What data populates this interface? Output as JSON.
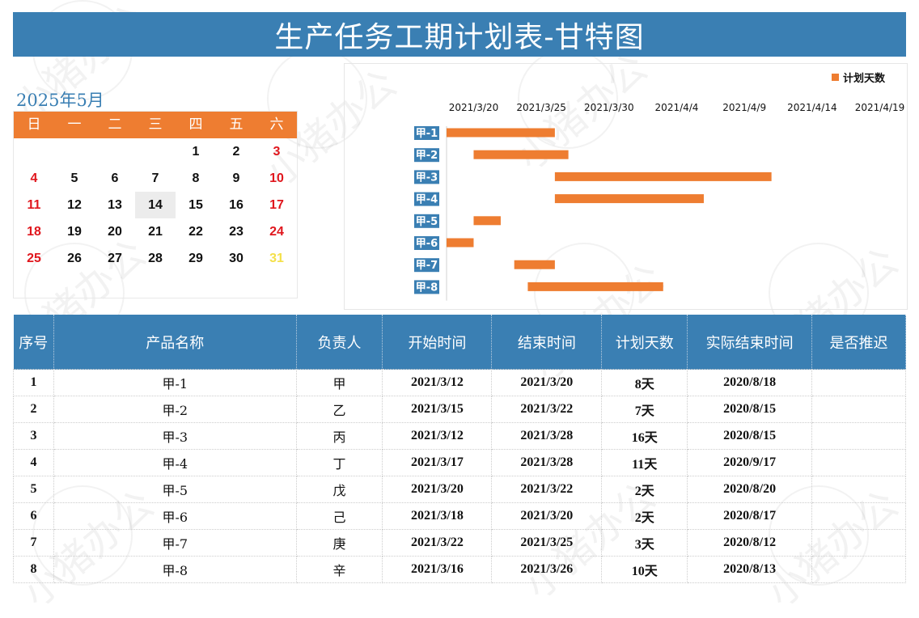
{
  "title": "生产任务工期计划表-甘特图",
  "watermark": "小猪办公",
  "colors": {
    "header_blue": "#3a7fb3",
    "accent_orange": "#ee7d31",
    "weekend_red": "#e0161d",
    "highlight_yellow": "#f4e04a"
  },
  "calendar": {
    "title": "2025年5月",
    "weekdays": [
      "日",
      "一",
      "二",
      "三",
      "四",
      "五",
      "六"
    ],
    "weeks": [
      [
        "",
        "",
        "",
        "",
        "1",
        "2",
        "3"
      ],
      [
        "4",
        "5",
        "6",
        "7",
        "8",
        "9",
        "10"
      ],
      [
        "11",
        "12",
        "13",
        "14",
        "15",
        "16",
        "17"
      ],
      [
        "18",
        "19",
        "20",
        "21",
        "22",
        "23",
        "24"
      ],
      [
        "25",
        "26",
        "27",
        "28",
        "29",
        "30",
        "31"
      ]
    ],
    "today": "14"
  },
  "chart_data": {
    "type": "bar",
    "orientation": "horizontal-gantt",
    "legend": [
      "计划天数"
    ],
    "legend_position": "top-right",
    "x_ticks": [
      "2021/3/20",
      "2021/3/25",
      "2021/3/30",
      "2021/4/4",
      "2021/4/9",
      "2021/4/14",
      "2021/4/19"
    ],
    "xlim": [
      "2021/3/18",
      "2021/4/21"
    ],
    "categories": [
      "甲-1",
      "甲-2",
      "甲-3",
      "甲-4",
      "甲-5",
      "甲-6",
      "甲-7",
      "甲-8"
    ],
    "series": [
      {
        "name": "计划天数",
        "color": "#ee7d31",
        "start": [
          "2021/3/18",
          "2021/3/20",
          "2021/3/26",
          "2021/3/26",
          "2021/3/20",
          "2021/3/18",
          "2021/3/23",
          "2021/3/24"
        ],
        "end": [
          "2021/3/26",
          "2021/3/27",
          "2021/4/11",
          "2021/4/6",
          "2021/3/22",
          "2021/3/20",
          "2021/3/26",
          "2021/4/3"
        ]
      }
    ],
    "grid": false
  },
  "table": {
    "headers": [
      "序号",
      "产品名称",
      "负责人",
      "开始时间",
      "结束时间",
      "计划天数",
      "实际结束时间",
      "是否推迟"
    ],
    "rows": [
      [
        "1",
        "甲-1",
        "甲",
        "2021/3/12",
        "2021/3/20",
        "8天",
        "2020/8/18",
        ""
      ],
      [
        "2",
        "甲-2",
        "乙",
        "2021/3/15",
        "2021/3/22",
        "7天",
        "2020/8/15",
        ""
      ],
      [
        "3",
        "甲-3",
        "丙",
        "2021/3/12",
        "2021/3/28",
        "16天",
        "2020/8/15",
        ""
      ],
      [
        "4",
        "甲-4",
        "丁",
        "2021/3/17",
        "2021/3/28",
        "11天",
        "2020/9/17",
        ""
      ],
      [
        "5",
        "甲-5",
        "戊",
        "2021/3/20",
        "2021/3/22",
        "2天",
        "2020/8/20",
        ""
      ],
      [
        "6",
        "甲-6",
        "己",
        "2021/3/18",
        "2021/3/20",
        "2天",
        "2020/8/17",
        ""
      ],
      [
        "7",
        "甲-7",
        "庚",
        "2021/3/22",
        "2021/3/25",
        "3天",
        "2020/8/12",
        ""
      ],
      [
        "8",
        "甲-8",
        "辛",
        "2021/3/16",
        "2021/3/26",
        "10天",
        "2020/8/13",
        ""
      ]
    ]
  }
}
